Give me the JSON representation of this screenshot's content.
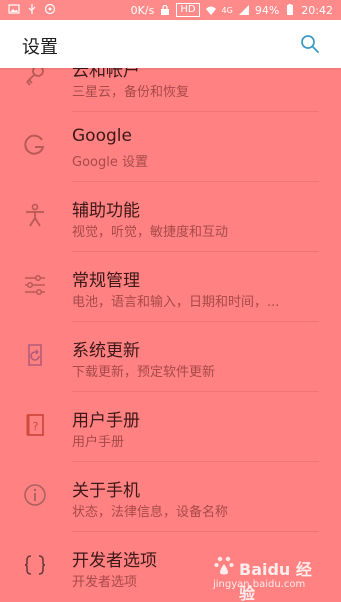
{
  "status_bar": {
    "network_speed": "0K/s",
    "hd": "HD",
    "signal_type": "4G",
    "battery": "94%",
    "time": "20:42"
  },
  "header": {
    "title": "设置",
    "search_icon": "search-icon"
  },
  "items": [
    {
      "icon": "cloud-key-icon",
      "title": "云和帐户",
      "subtitle": "三星云，备份和恢复"
    },
    {
      "icon": "google-g-icon",
      "title": "Google",
      "subtitle": "Google 设置"
    },
    {
      "icon": "accessibility-icon",
      "title": "辅助功能",
      "subtitle": "视觉，听觉，敏捷度和互动"
    },
    {
      "icon": "sliders-icon",
      "title": "常规管理",
      "subtitle": "电池，语言和输入，日期和时间，..."
    },
    {
      "icon": "system-update-icon",
      "title": "系统更新",
      "subtitle": "下载更新，预定软件更新"
    },
    {
      "icon": "user-manual-icon",
      "title": "用户手册",
      "subtitle": "用户手册"
    },
    {
      "icon": "info-icon",
      "title": "关于手机",
      "subtitle": "状态，法律信息，设备名称"
    },
    {
      "icon": "developer-braces-icon",
      "title": "开发者选项",
      "subtitle": "开发者选项"
    }
  ],
  "watermark": {
    "brand": "Baidu 经验",
    "url": "jingyan.baidu.com"
  },
  "colors": {
    "overlay": "#ff8181",
    "header_bg": "#ffffff",
    "title_text": "#3c1818",
    "subtitle_text": "#a74a4a"
  }
}
